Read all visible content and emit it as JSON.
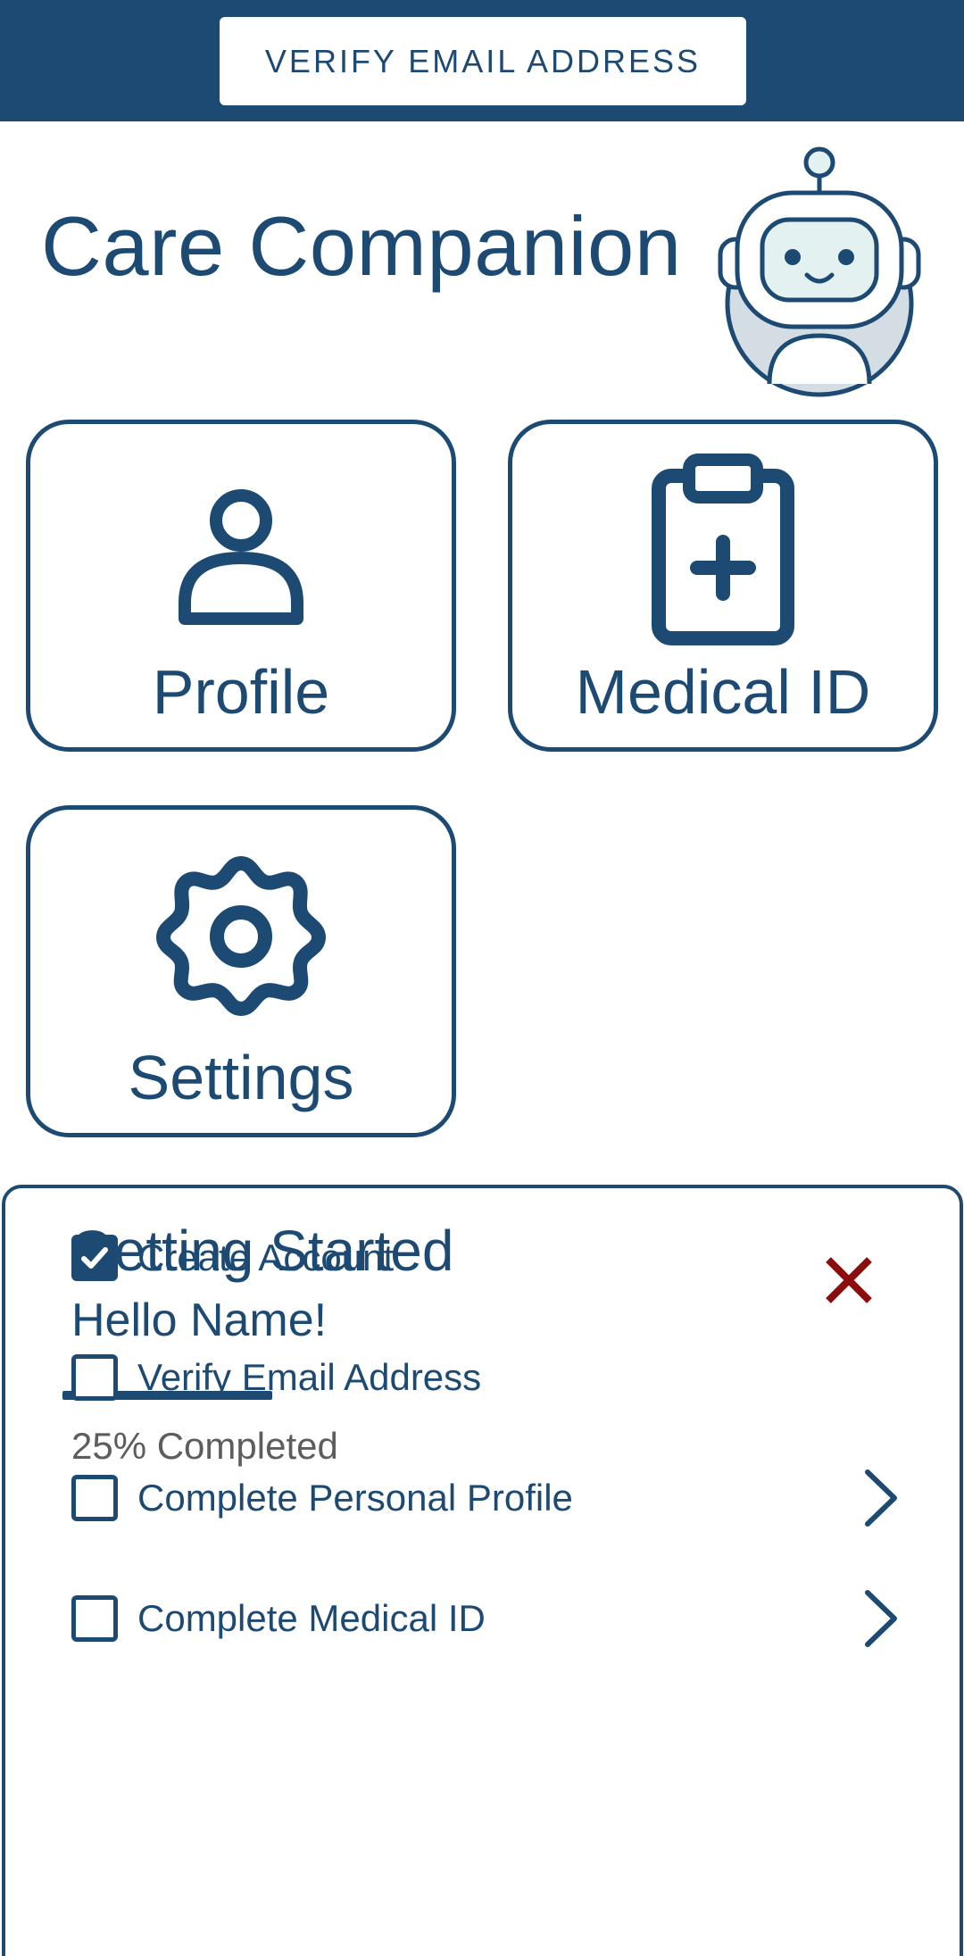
{
  "header": {
    "verify_button_label": "VERIFY EMAIL ADDRESS"
  },
  "app": {
    "title": "Care Companion",
    "mascot_icon": "robot-mascot-icon"
  },
  "tiles": [
    {
      "label": "Profile",
      "icon": "person-icon"
    },
    {
      "label": "Medical ID",
      "icon": "clipboard-medical-icon"
    },
    {
      "label": "Settings",
      "icon": "gear-icon"
    }
  ],
  "getting_started": {
    "title": "Getting Started",
    "greeting": "Hello Name!",
    "progress_percent": 25,
    "progress_text": "25% Completed",
    "close_icon": "close-icon",
    "tasks": [
      {
        "label": "Create Account",
        "checked": true,
        "has_chevron": false
      },
      {
        "label": "Verify Email Address",
        "checked": false,
        "has_chevron": false
      },
      {
        "label": "Complete Personal Profile",
        "checked": false,
        "has_chevron": true
      },
      {
        "label": "Complete Medical ID",
        "checked": false,
        "has_chevron": true
      }
    ]
  },
  "colors": {
    "primary": "#1d4a73",
    "close": "#8b0d0d",
    "muted_text": "#5d5d5d",
    "robot_face": "#e3f2f1",
    "robot_body": "#d3dde3"
  }
}
